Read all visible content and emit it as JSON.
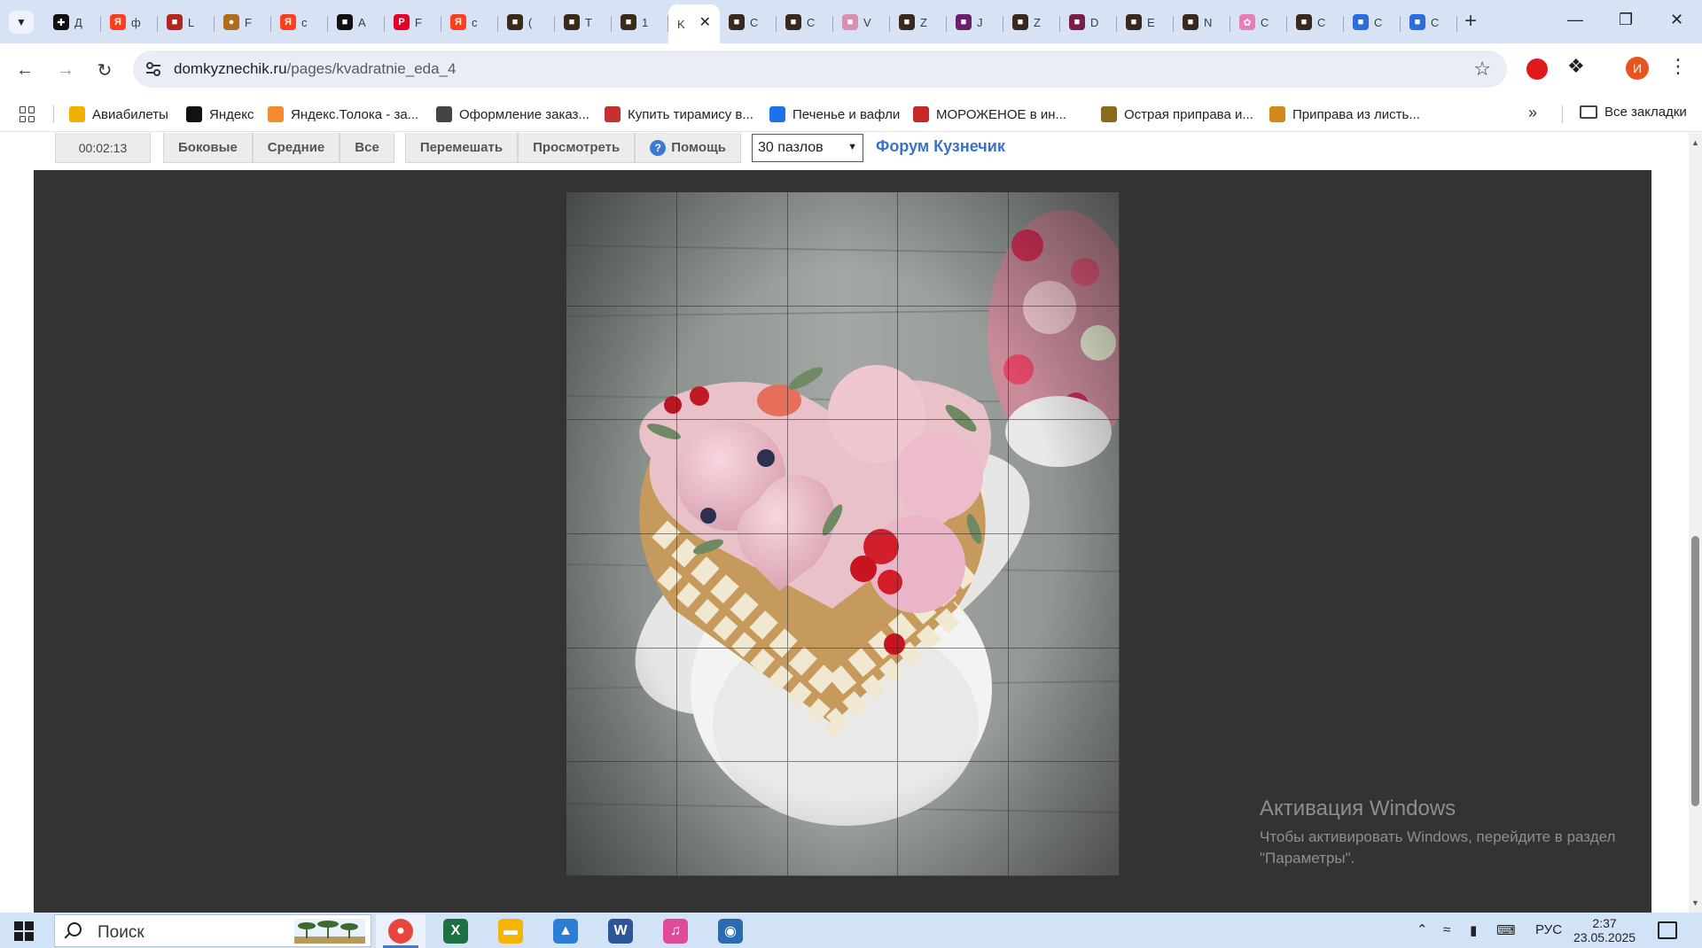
{
  "browser": {
    "tabs": [
      {
        "label": "Д",
        "color": "#111111",
        "glyph": "✚"
      },
      {
        "label": "ф",
        "color": "#fc3f1d",
        "glyph": "Я"
      },
      {
        "label": "L",
        "color": "#b3261e",
        "glyph": "■"
      },
      {
        "label": "F",
        "color": "#b06b1c",
        "glyph": "●"
      },
      {
        "label": "с",
        "color": "#fc3f1d",
        "glyph": "Я"
      },
      {
        "label": "A",
        "color": "#111111",
        "glyph": "■"
      },
      {
        "label": "F",
        "color": "#e60023",
        "glyph": "P"
      },
      {
        "label": "с",
        "color": "#fc3f1d",
        "glyph": "Я"
      },
      {
        "label": "(",
        "color": "#3b2a1a",
        "glyph": "■"
      },
      {
        "label": "T",
        "color": "#3b2a1a",
        "glyph": "■"
      },
      {
        "label": "1",
        "color": "#3b2a1a",
        "glyph": "■"
      },
      {
        "label": "K",
        "color": "#ffffff",
        "glyph": ""
      },
      {
        "label": "С",
        "color": "#3b2a1a",
        "glyph": "■"
      },
      {
        "label": "С",
        "color": "#3b2a1a",
        "glyph": "■"
      },
      {
        "label": "V",
        "color": "#d88fb0",
        "glyph": "■"
      },
      {
        "label": "Z",
        "color": "#3b2a1a",
        "glyph": "■"
      },
      {
        "label": "J",
        "color": "#6b1f6e",
        "glyph": "■"
      },
      {
        "label": "Z",
        "color": "#3b2a1a",
        "glyph": "■"
      },
      {
        "label": "D",
        "color": "#7a1d4a",
        "glyph": "■"
      },
      {
        "label": "E",
        "color": "#3b2a1a",
        "glyph": "■"
      },
      {
        "label": "N",
        "color": "#3b2a1a",
        "glyph": "■"
      },
      {
        "label": "С",
        "color": "#e87db5",
        "glyph": "✿"
      },
      {
        "label": "С",
        "color": "#3b2a1a",
        "glyph": "■"
      },
      {
        "label": "С",
        "color": "#2d6cdf",
        "glyph": "■"
      },
      {
        "label": "С",
        "color": "#2d6cdf",
        "glyph": "■"
      }
    ],
    "active_tab_index": 11,
    "url_domain": "domkyznechik.ru",
    "url_path": "/pages/kvadratnie_eda_4",
    "avatar_letter": "И"
  },
  "bookmarks": [
    {
      "label": "Авиабилеты",
      "color": "#f2b100"
    },
    {
      "label": "Яндекс",
      "color": "#111111"
    },
    {
      "label": "Яндекс.Толока - за...",
      "color": "#f28a2e"
    },
    {
      "label": "Оформление заказ...",
      "color": "#444444"
    },
    {
      "label": "Купить тирамису в...",
      "color": "#c43131"
    },
    {
      "label": "Печенье и вафли",
      "color": "#1a73e8"
    },
    {
      "label": "МОРОЖЕНОЕ в ин...",
      "color": "#c62828"
    },
    {
      "label": "Острая приправа и...",
      "color": "#8a6a1c"
    },
    {
      "label": "Приправа из листь...",
      "color": "#d08a1a"
    }
  ],
  "all_bookmarks_label": "Все закладки",
  "puzzle": {
    "timer": "00:02:13",
    "filter_buttons": [
      "Боковые",
      "Средние",
      "Все"
    ],
    "action_buttons": [
      "Перемешать",
      "Просмотреть"
    ],
    "help_label": "Помощь",
    "piece_count": "30 пазлов",
    "forum_link": "Форум Кузнечик",
    "grid": {
      "columns": 5,
      "rows": 6
    }
  },
  "windows_activation": {
    "title": "Активация Windows",
    "line1": "Чтобы активировать Windows, перейдите в раздел",
    "line2": "\"Параметры\"."
  },
  "taskbar": {
    "search_placeholder": "Поиск",
    "apps": [
      {
        "name": "chrome",
        "color": "#e8453c",
        "glyph": "●",
        "active": true
      },
      {
        "name": "excel",
        "color": "#1d7044",
        "glyph": "X",
        "active": false
      },
      {
        "name": "explorer",
        "color": "#f4b400",
        "glyph": "▬",
        "active": false
      },
      {
        "name": "photos",
        "color": "#2a7fd4",
        "glyph": "▲",
        "active": false
      },
      {
        "name": "word",
        "color": "#2b579a",
        "glyph": "W",
        "active": false
      },
      {
        "name": "itunes",
        "color": "#e04a9a",
        "glyph": "♫",
        "active": false
      },
      {
        "name": "app",
        "color": "#2b6cb0",
        "glyph": "◉",
        "active": false
      }
    ],
    "language": "РУС",
    "time": "2:37",
    "date": "23.05.2025"
  }
}
